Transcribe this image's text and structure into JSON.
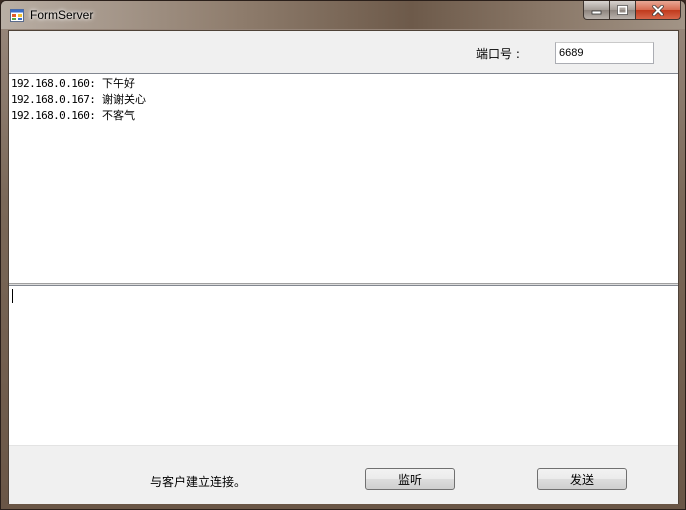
{
  "window": {
    "title": "FormServer",
    "minimize_glyph": "▁",
    "maximize_glyph": "□",
    "close_glyph": "✕"
  },
  "top_panel": {
    "port_label": "端口号 :",
    "port_value": "6689"
  },
  "messages": [
    {
      "ip": "192.168.0.160:",
      "text": "下午好"
    },
    {
      "ip": "192.168.0.167:",
      "text": "谢谢关心"
    },
    {
      "ip": "192.168.0.160:",
      "text": "不客气"
    }
  ],
  "compose": {
    "value": ""
  },
  "bottom_panel": {
    "status": "与客户建立连接。",
    "listen_label": "监听",
    "send_label": "发送"
  },
  "icons": {
    "app": "form-app-icon",
    "minimize": "minimize-icon",
    "maximize": "maximize-icon",
    "close": "close-icon"
  },
  "colors": {
    "close_button": "#c0391c",
    "client_background": "#f0f0f0"
  }
}
